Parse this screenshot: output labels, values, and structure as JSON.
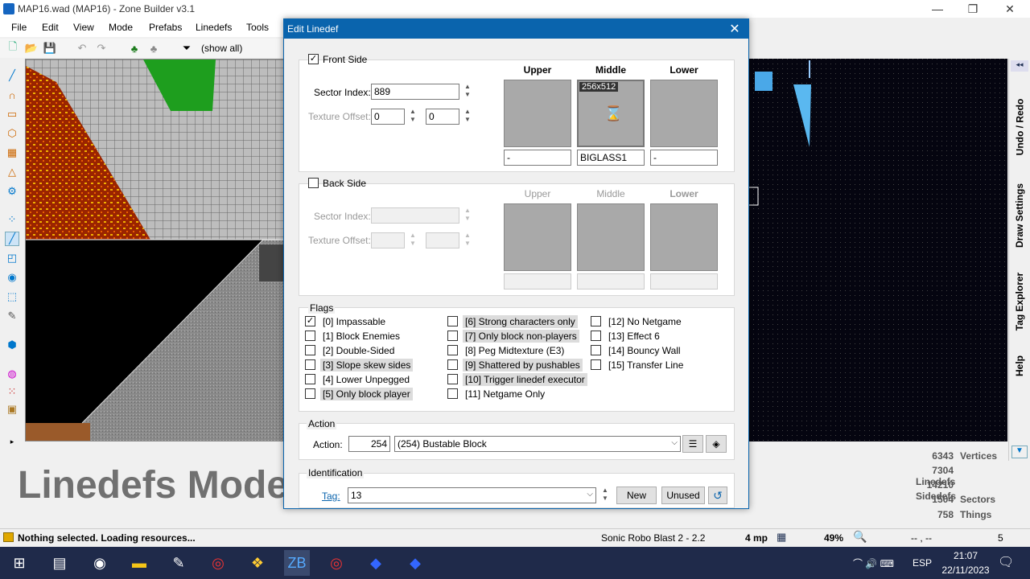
{
  "app": {
    "title": "MAP16.wad (MAP16) - Zone Builder v3.1"
  },
  "window_controls": [
    "—",
    "❐",
    "✕"
  ],
  "menu": [
    "File",
    "Edit",
    "View",
    "Mode",
    "Prefabs",
    "Linedefs",
    "Tools"
  ],
  "toolbar": {
    "filter_label": "(show all)"
  },
  "right_tabs": [
    "Undo / Redo",
    "Draw Settings",
    "Tag Explorer",
    "Help"
  ],
  "mode_label": "Linedefs Mode",
  "stats": [
    {
      "value": "6343",
      "label": "Vertices"
    },
    {
      "value": "7304",
      "label": "Linedefs"
    },
    {
      "value": "14210",
      "label": "Sidedefs"
    },
    {
      "value": "1504",
      "label": "Sectors"
    },
    {
      "value": "758",
      "label": "Things"
    }
  ],
  "status": {
    "message": "Nothing selected. Loading resources...",
    "game": "Sonic Robo Blast 2 - 2.2",
    "grid": "4 mp",
    "zoom": "49%",
    "coords": "-- , --",
    "count": "5"
  },
  "taskbar": {
    "lang": "ESP",
    "time": "21:07",
    "date": "22/11/2023"
  },
  "dialog": {
    "title": "Edit Linedef",
    "front": {
      "label": "Front Side",
      "checked": "✓",
      "sector_index_label": "Sector Index:",
      "sector_index": "889",
      "texture_offset_label": "Texture Offset:",
      "offset_x": "0",
      "offset_y": "0",
      "upper_label": "Upper",
      "middle_label": "Middle",
      "lower_label": "Lower",
      "upper_tex": "-",
      "middle_tex": "BIGLASS1",
      "lower_tex": "-",
      "middle_size": "256x512"
    },
    "back": {
      "label": "Back Side",
      "sector_index_label": "Sector Index:",
      "texture_offset_label": "Texture Offset:",
      "upper_label": "Upper",
      "middle_label": "Middle",
      "lower_label": "Lower"
    },
    "flags_label": "Flags",
    "flags": [
      {
        "text": "[0] Impassable",
        "checked": "✓",
        "hl": false
      },
      {
        "text": "[1] Block Enemies",
        "checked": "",
        "hl": false
      },
      {
        "text": "[2] Double-Sided",
        "checked": "",
        "hl": false
      },
      {
        "text": "[3] Slope skew sides",
        "checked": "",
        "hl": true
      },
      {
        "text": "[4] Lower Unpegged",
        "checked": "",
        "hl": false
      },
      {
        "text": "[5] Only block player",
        "checked": "",
        "hl": true
      },
      {
        "text": "[6] Strong characters only",
        "checked": "",
        "hl": true
      },
      {
        "text": "[7] Only block non-players",
        "checked": "",
        "hl": true
      },
      {
        "text": "[8] Peg Midtexture (E3)",
        "checked": "",
        "hl": false
      },
      {
        "text": "[9] Shattered by pushables",
        "checked": "",
        "hl": true
      },
      {
        "text": "[10] Trigger linedef executor",
        "checked": "",
        "hl": true
      },
      {
        "text": "[11] Netgame Only",
        "checked": "",
        "hl": false
      },
      {
        "text": "[12] No Netgame",
        "checked": "",
        "hl": false
      },
      {
        "text": "[13] Effect 6",
        "checked": "",
        "hl": false
      },
      {
        "text": "[14] Bouncy Wall",
        "checked": "",
        "hl": false
      },
      {
        "text": "[15] Transfer Line",
        "checked": "",
        "hl": false
      }
    ],
    "action_group": "Action",
    "action_label": "Action:",
    "action_number": "254",
    "action_value": "(254) Bustable Block",
    "ident_group": "Identification",
    "tag_label": "Tag:",
    "tag_value": "13",
    "new_label": "New",
    "unused_label": "Unused"
  },
  "colors": {
    "accent": "#0a64ad",
    "taskbar": "#1f2a4a"
  }
}
